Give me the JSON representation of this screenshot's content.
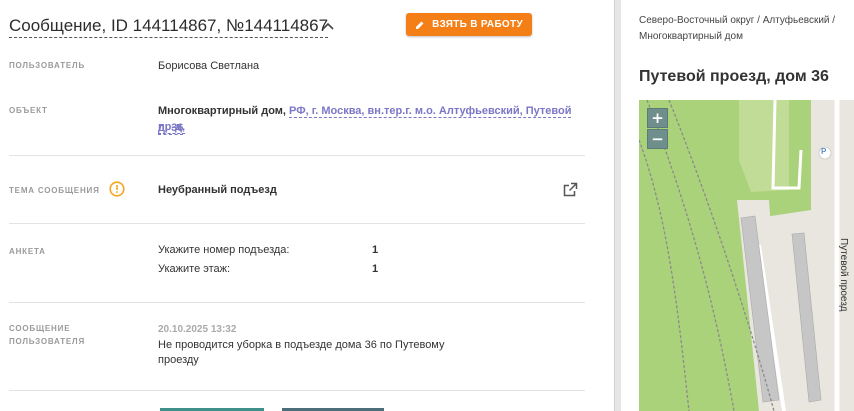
{
  "header": {
    "title": "Сообщение, ID 144114867, №144114867",
    "take_button_label": "ВЗЯТЬ В РАБОТУ"
  },
  "fields": {
    "user": {
      "label": "ПОЛЬЗОВАТЕЛЬ",
      "value": "Борисова Светлана"
    },
    "object": {
      "label": "ОБЪЕКТ",
      "type": "Многоквартирный дом,",
      "address_line1": "РФ, г. Москва, вн.тер.г. м.о. Алтуфьевский, Путевой пр-д,",
      "address_line2": "д. 36"
    },
    "topic": {
      "label": "ТЕМА СООБЩЕНИЯ",
      "value": "Неубранный подъезд"
    },
    "survey": {
      "label": "АНКЕТА",
      "rows": [
        {
          "question": "Укажите номер подъезда:",
          "answer": "1"
        },
        {
          "question": "Укажите этаж:",
          "answer": "1"
        }
      ]
    },
    "message": {
      "label_line1": "СООБЩЕНИЕ",
      "label_line2": "ПОЛЬЗОВАТЕЛЯ",
      "timestamp": "20.10.2025 13:32",
      "text": "Не проводится уборка в подъезде дома 36 по Путевому проезду"
    }
  },
  "sidebar": {
    "breadcrumb_line1": "Северо-Восточный округ / Алтуфьевский /",
    "breadcrumb_line2": "Многоквартирный дом",
    "address_title": "Путевой проезд, дом 36",
    "map": {
      "zoom_in": "+",
      "zoom_out": "−",
      "street_label": "Путевой проезд",
      "parking_marker": "P"
    }
  },
  "colors": {
    "accent": "#f57f17",
    "link": "#7b77c7",
    "warning": "#f5a623",
    "map_green": "#a9d27a"
  },
  "icons": {
    "title_toggle": "chevron-up-icon",
    "take_button": "pencil-icon",
    "topic_alert": "warning-circle-icon",
    "topic_open": "external-link-icon"
  }
}
